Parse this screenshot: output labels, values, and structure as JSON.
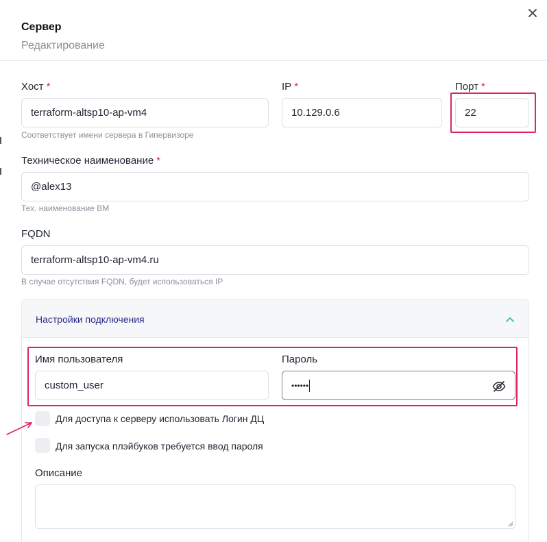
{
  "header": {
    "title": "Сервер",
    "subtitle": "Редактирование"
  },
  "fields": {
    "host": {
      "label": "Хост",
      "required": "*",
      "value": "terraform-altsp10-ap-vm4",
      "hint": "Соответствует имени сервера в Гипервизоре"
    },
    "ip": {
      "label": "IP",
      "required": "*",
      "value": "10.129.0.6"
    },
    "port": {
      "label": "Порт",
      "required": "*",
      "value": "22"
    },
    "tech_name": {
      "label": "Техническое наименование",
      "required": "*",
      "value": "@alex13",
      "hint": "Тех. наименование ВМ"
    },
    "fqdn": {
      "label": "FQDN",
      "value": "terraform-altsp10-ap-vm4.ru",
      "hint": "В случае отсутствия FQDN, будет использоваться IP"
    }
  },
  "connection": {
    "title": "Настройки подключения",
    "username": {
      "label": "Имя пользователя",
      "value": "custom_user"
    },
    "password": {
      "label": "Пароль",
      "value": "••••••"
    },
    "checkbox_dc_login": "Для доступа к серверу использовать Логин ДЦ",
    "checkbox_playbook_password": "Для запуска плэйбуков требуется ввод пароля",
    "description": {
      "label": "Описание",
      "value": ""
    }
  },
  "colors": {
    "accent": "#e0245e",
    "section_title": "#2c2c8a",
    "chevron": "#2bb3a3"
  },
  "icons": {
    "close": "close-icon",
    "chevron": "chevron-up-icon",
    "eye": "eye-off-icon"
  }
}
